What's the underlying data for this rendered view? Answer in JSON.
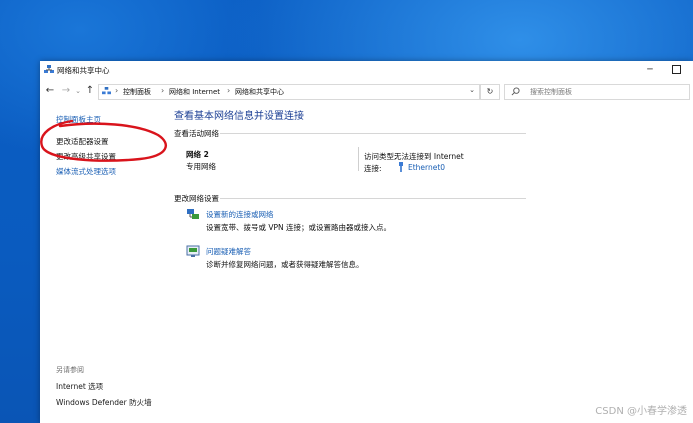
{
  "window": {
    "title": "网络和共享中心",
    "minimize_glyph": "─",
    "colors": {
      "accent": "#1a5fb4",
      "heading": "#1c3f94",
      "desktop": "#0a5bbf"
    }
  },
  "navbar": {
    "back": "←",
    "forward": "→",
    "dropdown": "⌄",
    "up": "↑",
    "breadcrumb": [
      "控制面板",
      "网络和 Internet",
      "网络和共享中心"
    ],
    "separator": "›",
    "address_dropdown": "⌄",
    "refresh": "↻",
    "search_placeholder": "搜索控制面板"
  },
  "sidebar": {
    "links": [
      "控制面板主页",
      "更改适配器设置",
      "更改高级共享设置",
      "媒体流式处理选项"
    ],
    "see_also_title": "另请参阅",
    "see_also": [
      "Internet 选项",
      "Windows Defender 防火墙"
    ]
  },
  "main": {
    "heading": "查看基本网络信息并设置连接",
    "active_networks_label": "查看活动网络",
    "network": {
      "name": "网络 2",
      "type": "专用网络",
      "access_type_label": "访问类型:",
      "access_type_value": "无法连接到 Internet",
      "connection_label": "连接:",
      "connection_value": "Ethernet0"
    },
    "change_settings_label": "更改网络设置",
    "tasks": [
      {
        "icon": "network-setup-icon",
        "title": "设置新的连接或网络",
        "desc": "设置宽带、拨号或 VPN 连接；或设置路由器或接入点。"
      },
      {
        "icon": "troubleshoot-icon",
        "title": "问题疑难解答",
        "desc": "诊断并修复网络问题，或者获得疑难解答信息。"
      }
    ]
  },
  "watermark": "CSDN @小春学渗透"
}
